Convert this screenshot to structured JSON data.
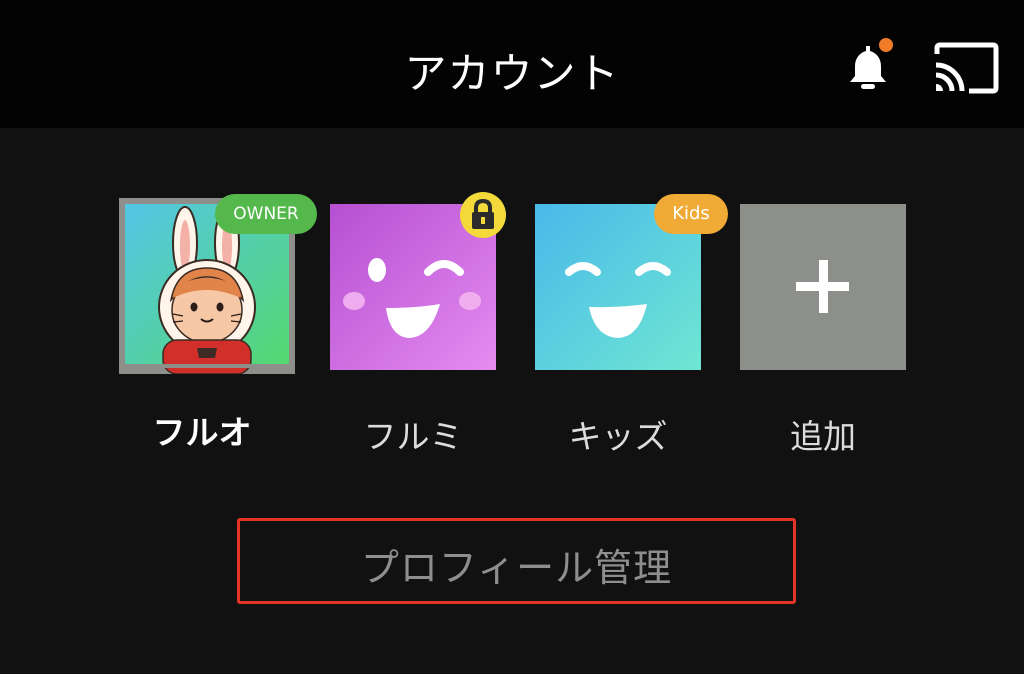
{
  "header": {
    "title": "アカウント",
    "notification_dot_color": "#f07c2a"
  },
  "profiles": [
    {
      "name": "フルオ",
      "badge": "OWNER",
      "selected": true,
      "avatar": "bunny-character-avatar"
    },
    {
      "name": "フルミ",
      "badge": "lock",
      "avatar": "wink-face-avatar"
    },
    {
      "name": "キッズ",
      "badge": "Kids",
      "avatar": "smile-face-avatar"
    },
    {
      "name": "追加",
      "avatar": "plus-icon"
    }
  ],
  "manage_button": {
    "label": "プロフィール管理",
    "highlight_color": "#e53425"
  },
  "colors": {
    "background": "#111111",
    "header_background": "#030303",
    "owner_badge": "#55b84c",
    "kids_badge": "#f0ab36",
    "lock_badge": "#f3da3a"
  }
}
